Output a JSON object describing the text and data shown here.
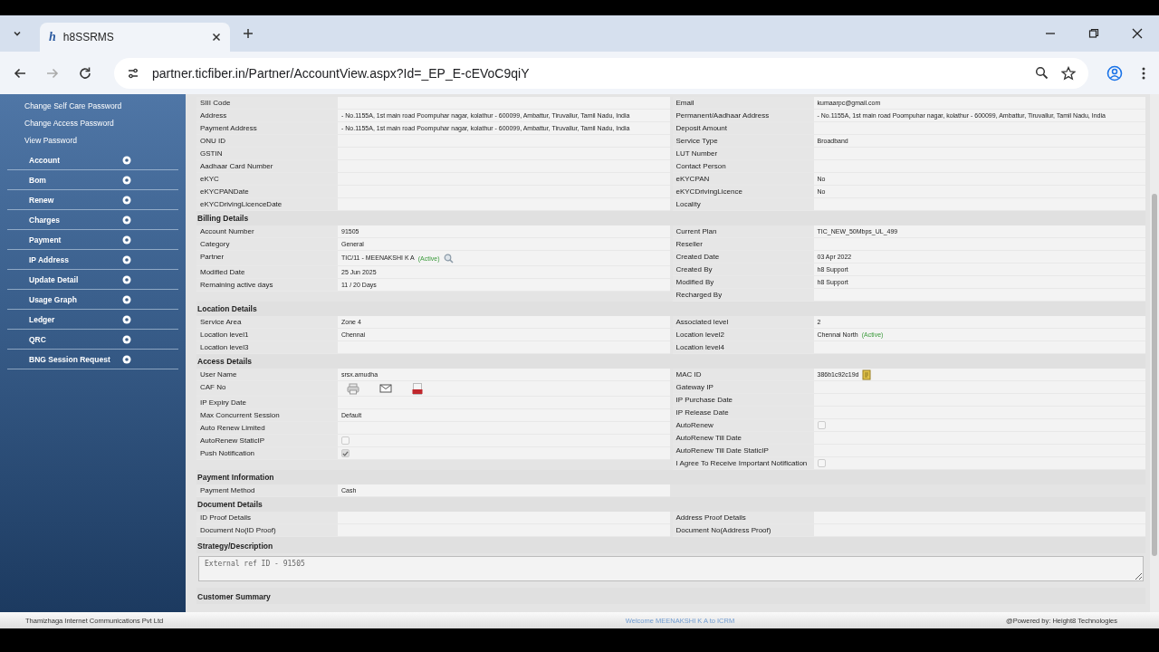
{
  "browser": {
    "tab": {
      "favicon": "h",
      "title": "h8SSRMS"
    },
    "url": "partner.ticfiber.in/Partner/AccountView.aspx?Id=_EP_E-cEVoC9qiY"
  },
  "sidebar": {
    "links": [
      "Change Self Care Password",
      "Change Access Password",
      "View Password"
    ],
    "items": [
      "Account",
      "Bom",
      "Renew",
      "Charges",
      "Payment",
      "IP Address",
      "Update Detail",
      "Usage Graph",
      "Ledger",
      "QRC",
      "BNG Session Request"
    ]
  },
  "sections": [
    {
      "kind": "fields",
      "left": [
        {
          "kind": "text",
          "label": "SIII Code"
        },
        {
          "kind": "text",
          "label": "Address",
          "value": "- No.1155A, 1st main road Poompuhar nagar, kolathur - 600099, Ambattur, Tiruvallur, Tamil Nadu, India"
        },
        {
          "kind": "text",
          "label": "Payment Address",
          "value": "- No.1155A, 1st main road Poompuhar nagar, kolathur - 600099, Ambattur, Tiruvallur, Tamil Nadu, India"
        },
        {
          "kind": "text",
          "label": "ONU ID"
        },
        {
          "kind": "text",
          "label": "GSTIN"
        },
        {
          "kind": "text",
          "label": "Aadhaar Card Number"
        },
        {
          "kind": "text",
          "label": "eKYC"
        },
        {
          "kind": "text",
          "label": "eKYCPANDate"
        },
        {
          "kind": "text",
          "label": "eKYCDrivingLicenceDate"
        }
      ],
      "right": [
        {
          "kind": "text",
          "label": "Email",
          "value": "kumaarpc@gmail.com"
        },
        {
          "kind": "text",
          "label": "Permanent/Aadhaar Address",
          "value": "- No.1155A, 1st main road Poompuhar nagar, kolathur - 600099, Ambattur, Tiruvallur, Tamil Nadu, India"
        },
        {
          "kind": "text",
          "label": "Deposit Amount"
        },
        {
          "kind": "text",
          "label": "Service Type",
          "value": "Broadband"
        },
        {
          "kind": "text",
          "label": "LUT Number"
        },
        {
          "kind": "text",
          "label": "Contact Person"
        },
        {
          "kind": "text",
          "label": "eKYCPAN",
          "value": "No"
        },
        {
          "kind": "text",
          "label": "eKYCDrivingLicence",
          "value": "No"
        },
        {
          "kind": "text",
          "label": "Locality"
        }
      ]
    },
    {
      "kind": "fields",
      "title": "Billing Details",
      "left": [
        {
          "kind": "text",
          "label": "Account Number",
          "value": "91505"
        },
        {
          "kind": "text",
          "label": "Category",
          "value": "General"
        },
        {
          "kind": "lookup",
          "label": "Partner",
          "value": "TIC/11 - MEENAKSHI K A",
          "status": "(Active)"
        },
        {
          "kind": "text",
          "label": "Modified Date",
          "value": "25 Jun 2025"
        },
        {
          "kind": "text",
          "label": "Remaining active days",
          "value": "11 / 20 Days"
        }
      ],
      "right": [
        {
          "kind": "text",
          "label": "Current Plan",
          "value": "TIC_NEW_50Mbps_UL_499"
        },
        {
          "kind": "text",
          "label": "Reseller"
        },
        {
          "kind": "text",
          "label": "Created Date",
          "value": "03 Apr 2022"
        },
        {
          "kind": "text",
          "label": "Created By",
          "value": "h8 Support"
        },
        {
          "kind": "text",
          "label": "Modified By",
          "value": "h8 Support"
        },
        {
          "kind": "text",
          "label": "Recharged By"
        }
      ]
    },
    {
      "kind": "fields",
      "title": "Location Details",
      "left": [
        {
          "kind": "text",
          "label": "Service Area",
          "value": "Zone 4"
        },
        {
          "kind": "text",
          "label": "Location level1",
          "value": "Chennai"
        },
        {
          "kind": "text",
          "label": "Location level3"
        }
      ],
      "right": [
        {
          "kind": "text",
          "label": "Associated level",
          "value": "2"
        },
        {
          "kind": "text",
          "label": "Location level2",
          "value": "Chennai North",
          "status": "(Active)"
        },
        {
          "kind": "text",
          "label": "Location level4"
        }
      ]
    },
    {
      "kind": "fields",
      "title": "Access Details",
      "left": [
        {
          "kind": "text",
          "label": "User Name",
          "value": "srsx.amudha"
        },
        {
          "kind": "icons",
          "label": "CAF No"
        },
        {
          "kind": "text",
          "label": "IP Expiry Date"
        },
        {
          "kind": "text",
          "label": "Max Concurrent Session",
          "value": "Default"
        },
        {
          "kind": "text",
          "label": "Auto Renew Limited"
        },
        {
          "kind": "checkbox",
          "label": "AutoRenew StaticIP",
          "checked": false,
          "disabled": true
        },
        {
          "kind": "checkbox",
          "label": "Push Notification",
          "checked": true,
          "disabled": true
        }
      ],
      "right": [
        {
          "kind": "note",
          "label": "MAC ID",
          "value": "386b1c92c19d"
        },
        {
          "kind": "text",
          "label": "Gateway IP"
        },
        {
          "kind": "text",
          "label": "IP Purchase Date"
        },
        {
          "kind": "text",
          "label": "IP Release Date"
        },
        {
          "kind": "checkbox",
          "label": "AutoRenew",
          "checked": false,
          "disabled": true
        },
        {
          "kind": "text",
          "label": "AutoRenew Till Date"
        },
        {
          "kind": "text",
          "label": "AutoRenew Till Date StaticIP"
        },
        {
          "kind": "checkbox",
          "label": "I Agree To Receive Important Notification",
          "checked": false,
          "disabled": true
        }
      ]
    },
    {
      "kind": "fields",
      "title": "Payment Information",
      "left": [
        {
          "kind": "text",
          "label": "Payment Method",
          "value": "Cash"
        }
      ]
    },
    {
      "kind": "fields",
      "title": "Document Details",
      "left": [
        {
          "kind": "text",
          "label": "ID Proof Details"
        },
        {
          "kind": "text",
          "label": "Document No(ID Proof)"
        }
      ],
      "right": [
        {
          "kind": "text",
          "label": "Address Proof Details"
        },
        {
          "kind": "text",
          "label": "Document No(Address Proof)"
        }
      ]
    },
    {
      "kind": "textarea",
      "title": "Strategy/Description",
      "value": "External ref ID - 91505"
    },
    {
      "kind": "heading",
      "title": "Customer Summary"
    }
  ],
  "footer": {
    "company": "Thamizhaga Internet Communications Pvt Ltd",
    "welcome": "Welcome MEENAKSHI K A to ICRM",
    "powered": "@Powered by: Height8 Technologies"
  }
}
